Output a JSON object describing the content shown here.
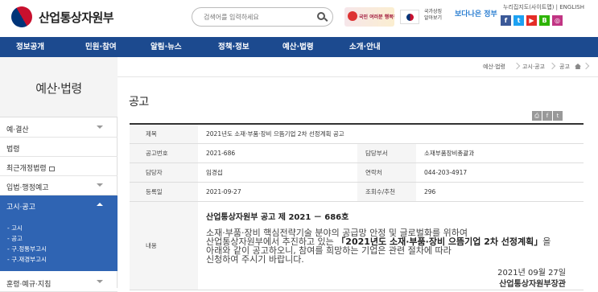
{
  "header": {
    "logo_text": "산업통상자원부",
    "search_placeholder": "검색어를 입력하세요",
    "banner_text": "국민 여러분 행복한국",
    "gukka_text": "국가상징 알아보기",
    "banner2_a": "보다나은",
    "banner2_b": "정부",
    "util_links": "누리집지도(사이트맵) | ENGLISH",
    "sns": [
      {
        "label": "f",
        "color": "#3b5998"
      },
      {
        "label": "t",
        "color": "#1da1f2"
      },
      {
        "label": "▶",
        "color": "#e52d27"
      },
      {
        "label": "B",
        "color": "#2db400"
      },
      {
        "label": "◎",
        "color": "#c13584"
      }
    ]
  },
  "gnb": [
    "정보공개",
    "민원·참여",
    "알림·뉴스",
    "정책·정보",
    "예산·법령",
    "소개·안내"
  ],
  "sidebar": {
    "title": "예산·법령",
    "items": [
      {
        "label": "예·결산",
        "has_chevron": true
      },
      {
        "label": "법령",
        "has_chevron": false
      },
      {
        "label": "최근개정법령",
        "has_chevron": false,
        "external": true
      },
      {
        "label": "입법·행정예고",
        "has_chevron": true
      },
      {
        "label": "고시·공고",
        "has_chevron": true,
        "active": true
      },
      {
        "label": "훈령·예규·지침",
        "has_chevron": true
      }
    ],
    "sub_items": [
      "- 고시",
      "- 공고",
      "- 구.정통부고시",
      "- 구.재경부고시"
    ]
  },
  "breadcrumb": [
    "예산·법령",
    "고시·공고",
    "공고"
  ],
  "page": {
    "title": "공고",
    "rows": [
      {
        "label": "제목",
        "value": "2021년도 소재·부품·장비 으뜸기업 2차 선정계획 공고"
      },
      {
        "label": "공고번호",
        "value": "2021-686",
        "label2": "담당부서",
        "value2": "소재부품장비총괄과"
      },
      {
        "label": "담당자",
        "value": "임경섭",
        "label2": "연락처",
        "value2": "044-203-4917"
      },
      {
        "label": "등록일",
        "value": "2021-09-27",
        "label2": "조회수/추천",
        "value2": "296"
      }
    ],
    "content_label": "내용",
    "content_head": "산업통상자원부 공고 제 2021 － 686호",
    "content_line1": "소재·부품·장비 핵심전략기술 분야의 공급망 안정 및 글로벌화를 위하여",
    "content_line2a": "산업통상자원부에서 추진하고 있는 ",
    "content_bold": "「2021년도 소재·부품·장비 으뜸기업 2차 선정계획」",
    "content_line2b": "을 아래와 같이 공고하오니, 참여를 희망하는 기업은 관련 절차에 따라",
    "content_line3": "신청하여 주시기 바랍니다.",
    "content_date": "2021년 09월 27일",
    "content_org": "산업통상자원부장관"
  }
}
